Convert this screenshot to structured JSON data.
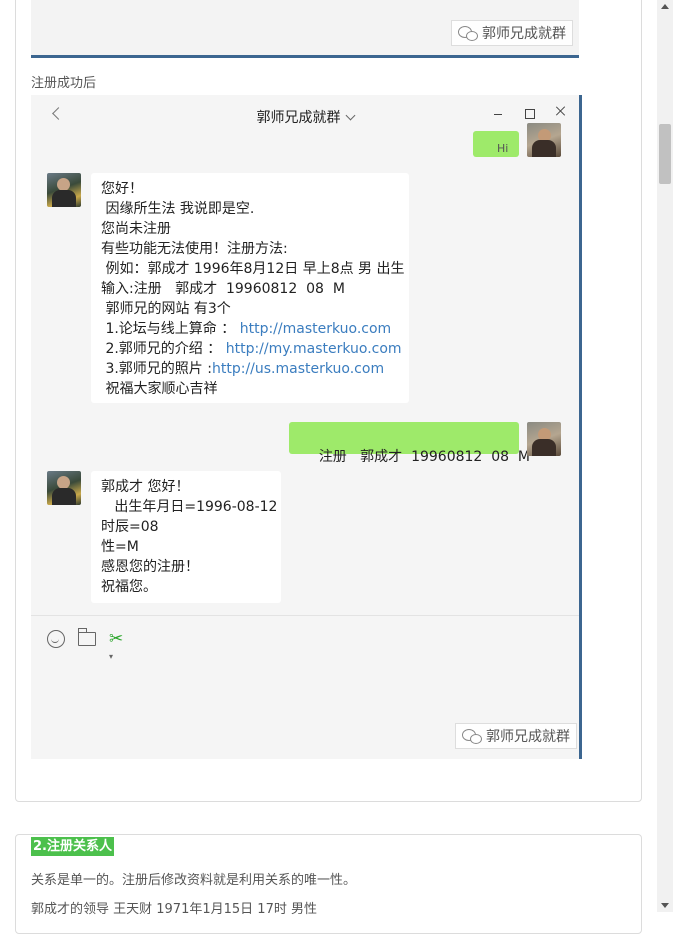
{
  "top_watermark": "郭师兄成就群",
  "caption": "注册成功后",
  "chat": {
    "title": "郭师兄成就群",
    "partial_bubble": "Hi",
    "messages": [
      {
        "side": "left",
        "lines": [
          "您好！",
          " 因缘所生法 我说即是空.",
          "您尚未注册",
          "有些功能无法使用！注册方法:",
          " 例如：郭成才 1996年8月12日 早上8点 男 出生",
          "输入:注册   郭成才  19960812  08  M",
          " 郭师兄的网站 有3个",
          " 1.论坛与线上算命 ：",
          " 2.郭师兄的介绍 ：",
          " 3.郭师兄的照片 :",
          " 祝福大家顺心吉祥"
        ],
        "links": [
          "http://masterkuo.com",
          "http://my.masterkuo.com",
          "http://us.masterkuo.com"
        ]
      },
      {
        "side": "right",
        "text": "注册   郭成才  19960812  08  M"
      },
      {
        "side": "left",
        "lines": [
          "郭成才 您好！",
          "   出生年月日=1996-08-12",
          "时辰=08",
          "性=M",
          "感恩您的注册！",
          "祝福您。"
        ]
      }
    ],
    "watermark": "郭师兄成就群",
    "icons": [
      "smile-icon",
      "folder-icon",
      "scissors-icon"
    ]
  },
  "section2": {
    "title": "2.注册关系人",
    "para1": "关系是单一的。注册后修改资料就是利用关系的唯一性。",
    "para2": "郭成才的领导 王天财 1971年1月15日   17时   男性"
  }
}
